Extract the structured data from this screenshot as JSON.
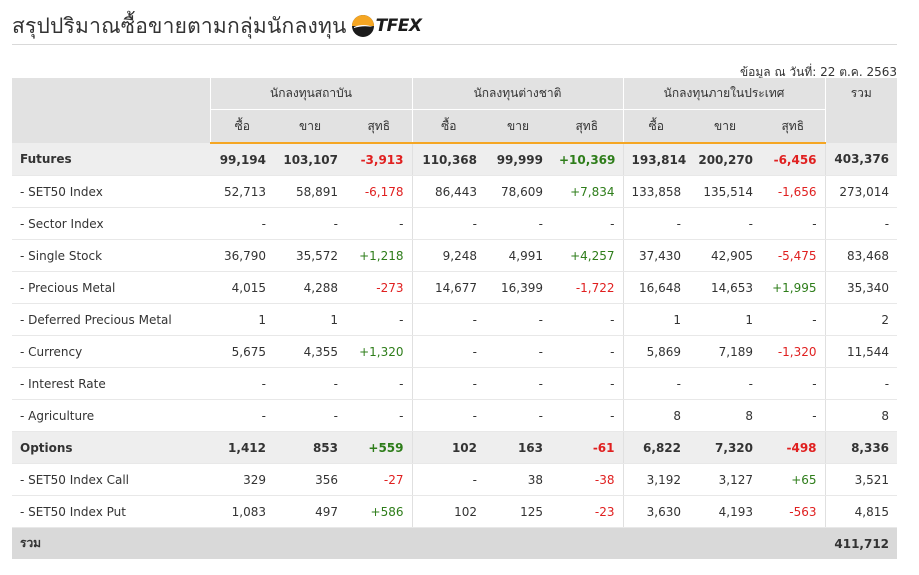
{
  "page": {
    "title": "สรุปปริมาณซื้อขายตามกลุ่มนักลงทุน",
    "logo_text": "TFEX",
    "as_of": "ข้อมูล ณ วันที่: 22 ต.ค. 2563"
  },
  "header": {
    "groups": [
      "นักลงทุนสถาบัน",
      "นักลงทุนต่างชาติ",
      "นักลงทุนภายในประเทศ"
    ],
    "total": "รวม",
    "buy": "ซื้อ",
    "sell": "ขาย",
    "net": "สุทธิ"
  },
  "rows": [
    {
      "label": "Futures",
      "main": true,
      "cells": [
        [
          "99,194",
          "103,107",
          "-3,913"
        ],
        [
          "110,368",
          "99,999",
          "+10,369"
        ],
        [
          "193,814",
          "200,270",
          "-6,456"
        ]
      ],
      "total": "403,376"
    },
    {
      "label": "- SET50 Index",
      "main": false,
      "cells": [
        [
          "52,713",
          "58,891",
          "-6,178"
        ],
        [
          "86,443",
          "78,609",
          "+7,834"
        ],
        [
          "133,858",
          "135,514",
          "-1,656"
        ]
      ],
      "total": "273,014"
    },
    {
      "label": "- Sector Index",
      "main": false,
      "cells": [
        [
          "-",
          "-",
          "-"
        ],
        [
          "-",
          "-",
          "-"
        ],
        [
          "-",
          "-",
          "-"
        ]
      ],
      "total": "-"
    },
    {
      "label": "- Single Stock",
      "main": false,
      "cells": [
        [
          "36,790",
          "35,572",
          "+1,218"
        ],
        [
          "9,248",
          "4,991",
          "+4,257"
        ],
        [
          "37,430",
          "42,905",
          "-5,475"
        ]
      ],
      "total": "83,468"
    },
    {
      "label": "- Precious Metal",
      "main": false,
      "cells": [
        [
          "4,015",
          "4,288",
          "-273"
        ],
        [
          "14,677",
          "16,399",
          "-1,722"
        ],
        [
          "16,648",
          "14,653",
          "+1,995"
        ]
      ],
      "total": "35,340"
    },
    {
      "label": "- Deferred Precious Metal",
      "main": false,
      "cells": [
        [
          "1",
          "1",
          "-"
        ],
        [
          "-",
          "-",
          "-"
        ],
        [
          "1",
          "1",
          "-"
        ]
      ],
      "total": "2"
    },
    {
      "label": "- Currency",
      "main": false,
      "cells": [
        [
          "5,675",
          "4,355",
          "+1,320"
        ],
        [
          "-",
          "-",
          "-"
        ],
        [
          "5,869",
          "7,189",
          "-1,320"
        ]
      ],
      "total": "11,544"
    },
    {
      "label": "- Interest Rate",
      "main": false,
      "cells": [
        [
          "-",
          "-",
          "-"
        ],
        [
          "-",
          "-",
          "-"
        ],
        [
          "-",
          "-",
          "-"
        ]
      ],
      "total": "-"
    },
    {
      "label": "- Agriculture",
      "main": false,
      "cells": [
        [
          "-",
          "-",
          "-"
        ],
        [
          "-",
          "-",
          "-"
        ],
        [
          "8",
          "8",
          "-"
        ]
      ],
      "total": "8"
    },
    {
      "label": "Options",
      "main": true,
      "cells": [
        [
          "1,412",
          "853",
          "+559"
        ],
        [
          "102",
          "163",
          "-61"
        ],
        [
          "6,822",
          "7,320",
          "-498"
        ]
      ],
      "total": "8,336"
    },
    {
      "label": "- SET50 Index Call",
      "main": false,
      "cells": [
        [
          "329",
          "356",
          "-27"
        ],
        [
          "-",
          "38",
          "-38"
        ],
        [
          "3,192",
          "3,127",
          "+65"
        ]
      ],
      "total": "3,521"
    },
    {
      "label": "- SET50 Index Put",
      "main": false,
      "cells": [
        [
          "1,083",
          "497",
          "+586"
        ],
        [
          "102",
          "125",
          "-23"
        ],
        [
          "3,630",
          "4,193",
          "-563"
        ]
      ],
      "total": "4,815"
    }
  ],
  "grand_total": {
    "label": "รวม",
    "value": "411,712"
  }
}
